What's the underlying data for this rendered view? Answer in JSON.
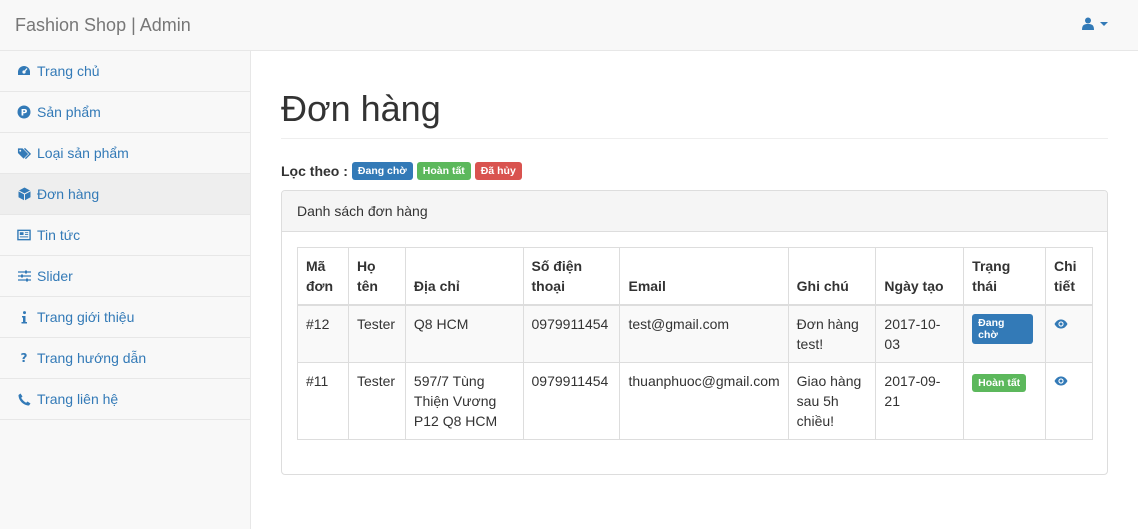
{
  "navbar": {
    "brand": "Fashion Shop | Admin",
    "user_icon": "user-icon"
  },
  "sidebar": {
    "items": [
      {
        "label": "Trang chủ",
        "icon": "dashboard-icon"
      },
      {
        "label": "Sản phẩm",
        "icon": "product-icon"
      },
      {
        "label": "Loại sản phẩm",
        "icon": "tags-icon"
      },
      {
        "label": "Đơn hàng",
        "icon": "order-icon"
      },
      {
        "label": "Tin tức",
        "icon": "news-icon"
      },
      {
        "label": "Slider",
        "icon": "sliders-icon"
      },
      {
        "label": "Trang giới thiệu",
        "icon": "info-icon"
      },
      {
        "label": "Trang hướng dẫn",
        "icon": "question-icon"
      },
      {
        "label": "Trang liên hệ",
        "icon": "phone-icon"
      }
    ],
    "active_index": 3
  },
  "main": {
    "title": "Đơn hàng",
    "filter": {
      "label": "Lọc theo :",
      "options": [
        "Đang chờ",
        "Hoàn tất",
        "Đã hủy"
      ]
    },
    "panel_title": "Danh sách đơn hàng",
    "table": {
      "headers": [
        "Mã đơn",
        "Họ tên",
        "Địa chỉ",
        "Số điện thoại",
        "Email",
        "Ghi chú",
        "Ngày tạo",
        "Trạng thái",
        "Chi tiết"
      ],
      "rows": [
        {
          "id": "#12",
          "name": "Tester",
          "address": "Q8 HCM",
          "phone": "0979911454",
          "email": "test@gmail.com",
          "note": "Đơn hàng test!",
          "date": "2017-10-03",
          "status": "Đang chờ",
          "status_color": "#337ab7"
        },
        {
          "id": "#11",
          "name": "Tester",
          "address": "597/7 Tùng Thiện Vương P12 Q8 HCM",
          "phone": "0979911454",
          "email": "thuanphuoc@gmail.com",
          "note": "Giao hàng sau 5h chiều!",
          "date": "2017-09-21",
          "status": "Hoàn tất",
          "status_color": "#5cb85c"
        }
      ]
    }
  },
  "colors": {
    "link": "#337ab7",
    "primary": "#337ab7",
    "success": "#5cb85c",
    "danger": "#d9534f"
  }
}
